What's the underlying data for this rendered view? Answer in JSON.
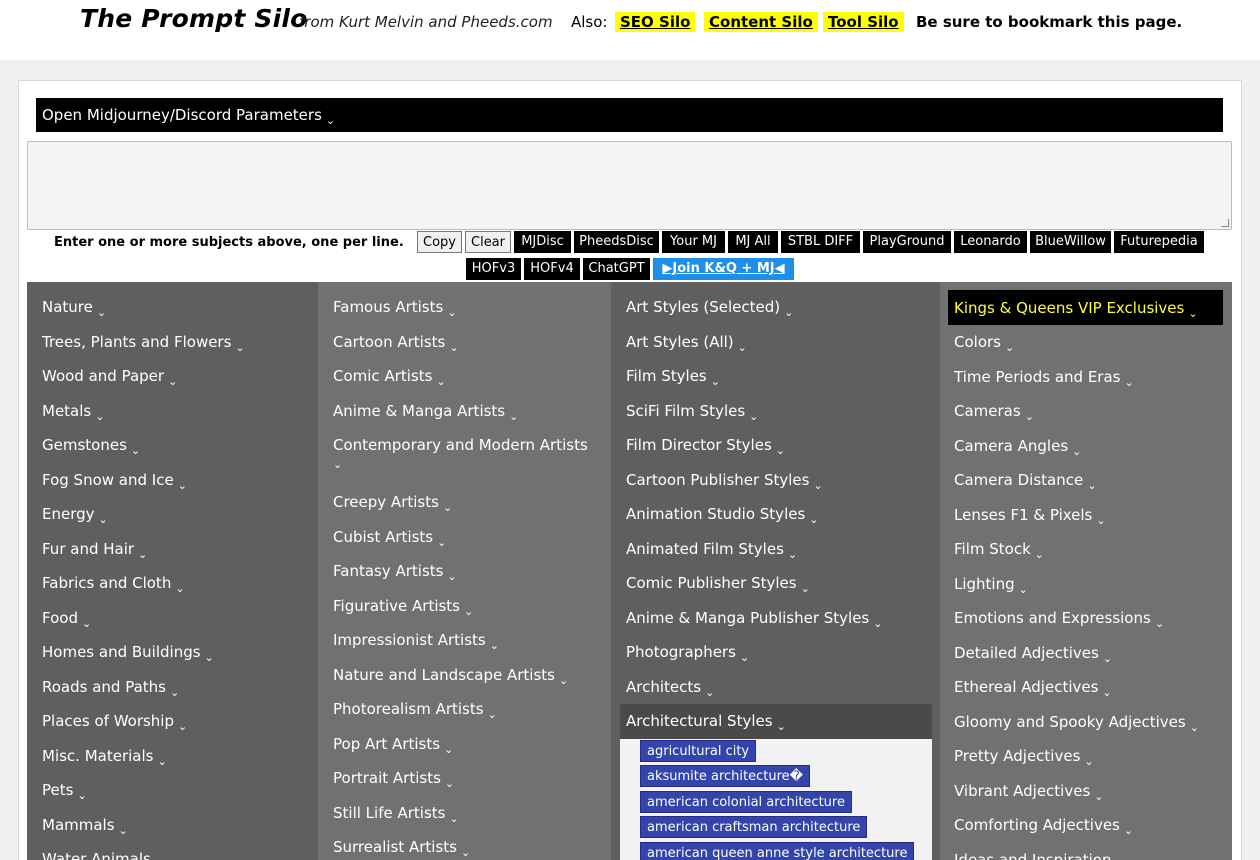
{
  "header": {
    "title": "The Prompt Silo",
    "subtitle": "from Kurt Melvin and Pheeds.com",
    "also_label": "Also:",
    "links": [
      "SEO Silo",
      "Content Silo",
      "Tool Silo"
    ],
    "bookmark": "Be sure to bookmark this page."
  },
  "params_bar": "Open Midjourney/Discord Parameters",
  "instructions": "Enter one or more subjects above, one per line.",
  "buttons_light": [
    "Copy",
    "Clear"
  ],
  "buttons_dark": [
    "MJDisc",
    "PheedsDisc",
    "Your MJ",
    "MJ All",
    "STBL DIFF",
    "PlayGround",
    "Leonardo",
    "BlueWillow",
    "Futurepedia",
    "HOFv3",
    "HOFv4",
    "ChatGPT"
  ],
  "join_button": "▶Join K&Q + MJ◀",
  "col1": [
    "Nature",
    "Trees, Plants and Flowers",
    "Wood and Paper",
    "Metals",
    "Gemstones",
    "Fog Snow and Ice",
    "Energy",
    "Fur and Hair",
    "Fabrics and Cloth",
    "Food",
    "Homes and Buildings",
    "Roads and Paths",
    "Places of Worship",
    "Misc. Materials",
    "Pets",
    "Mammals",
    "Water Animals"
  ],
  "col2": [
    "Famous Artists",
    "Cartoon Artists",
    "Comic Artists",
    "Anime & Manga Artists",
    "Contemporary and Modern Artists",
    "Creepy Artists",
    "Cubist Artists",
    "Fantasy Artists",
    "Figurative Artists",
    "Impressionist Artists",
    "Nature and Landscape Artists",
    "Photorealism Artists",
    "Pop Art Artists",
    "Portrait Artists",
    "Still Life Artists",
    "Surrealist Artists"
  ],
  "col3": [
    "Art Styles (Selected)",
    "Art Styles (All)",
    "Film Styles",
    "SciFi Film Styles",
    "Film Director Styles",
    "Cartoon Publisher Styles",
    "Animation Studio Styles",
    "Animated Film Styles",
    "Comic Publisher Styles",
    "Anime & Manga Publisher Styles",
    "Photographers",
    "Architects",
    "Architectural Styles"
  ],
  "col3_tags": [
    "agricultural city",
    "aksumite architecture�",
    "american colonial architecture",
    "american craftsman architecture",
    "american queen anne style architecture"
  ],
  "vip": "Kings & Queens VIP Exclusives",
  "col4": [
    "Colors",
    "Time Periods and Eras",
    "Cameras",
    "Camera Angles",
    "Camera Distance",
    "Lenses F1 & Pixels",
    "Film Stock",
    "Lighting",
    "Emotions and Expressions",
    "Detailed Adjectives",
    "Ethereal Adjectives",
    "Gloomy and Spooky Adjectives",
    "Pretty Adjectives",
    "Vibrant Adjectives",
    "Comforting Adjectives",
    "Ideas and Inspiration"
  ],
  "chevron_glyph": "⌄",
  "colors": {
    "highlight": "#ffff00",
    "vip_text": "#ffff33",
    "join_button": "#1e8fe8",
    "tag": "#3344aa"
  }
}
